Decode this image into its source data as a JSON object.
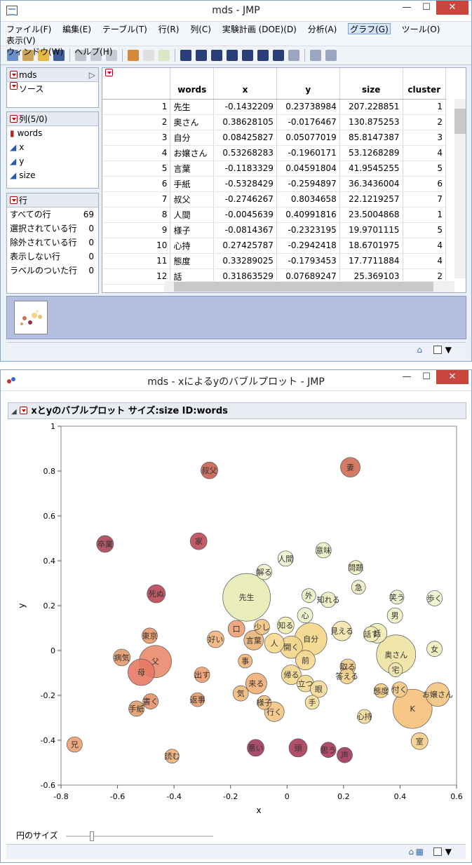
{
  "window1": {
    "title": "mds - JMP",
    "menus": [
      "ファイル(F)",
      "編集(E)",
      "テーブル(T)",
      "行(R)",
      "列(C)",
      "実験計画 (DOE)(D)",
      "分析(A)",
      "グラフ(G)",
      "ツール(O)",
      "表示(V)",
      "ウィンドウ(W)",
      "ヘルプ(H)"
    ],
    "selected_menu": "グラフ(G)",
    "left_panel": {
      "table_name": "mds",
      "source": "ソース",
      "columns_header": "列(5/0)",
      "columns": [
        "words",
        "x",
        "y",
        "size"
      ],
      "rows_header": "行",
      "row_stats": [
        {
          "label": "すべての行",
          "value": "69"
        },
        {
          "label": "選択されている行",
          "value": "0"
        },
        {
          "label": "除外されている行",
          "value": "0"
        },
        {
          "label": "表示しない行",
          "value": "0"
        },
        {
          "label": "ラベルのついた行",
          "value": "0"
        }
      ]
    },
    "table": {
      "headers": [
        "words",
        "x",
        "y",
        "size",
        "cluster"
      ],
      "rows": [
        [
          "1",
          "先生",
          "-0.1432209",
          "0.23738984",
          "207.228851",
          "1"
        ],
        [
          "2",
          "奥さん",
          "0.38628105",
          "-0.0176467",
          "130.875253",
          "2"
        ],
        [
          "3",
          "自分",
          "0.08425827",
          "0.05077019",
          "85.8147387",
          "3"
        ],
        [
          "4",
          "お嬢さん",
          "0.53268283",
          "-0.1960171",
          "53.1268289",
          "4"
        ],
        [
          "5",
          "言葉",
          "-0.1183329",
          "0.04591804",
          "41.9545255",
          "5"
        ],
        [
          "6",
          "手紙",
          "-0.5328429",
          "-0.2594897",
          "36.3436004",
          "6"
        ],
        [
          "7",
          "叔父",
          "-0.2746267",
          "0.8034658",
          "22.1219257",
          "7"
        ],
        [
          "8",
          "人間",
          "-0.0045639",
          "0.40991816",
          "23.5004868",
          "1"
        ],
        [
          "9",
          "様子",
          "-0.0814367",
          "-0.2323195",
          "19.9701115",
          "5"
        ],
        [
          "10",
          "心持",
          "0.27425787",
          "-0.2942418",
          "18.6701975",
          "4"
        ],
        [
          "11",
          "態度",
          "0.33289025",
          "-0.1793453",
          "17.7711884",
          "4"
        ],
        [
          "12",
          "話",
          "0.31863529",
          "0.07689247",
          "25.369103",
          "2"
        ]
      ]
    }
  },
  "window2": {
    "title": "mds - xによるyのバブルプロット - JMP",
    "report_title": "xとyのバブルプロット サイズ:size ID:words",
    "bubble_size_label": "円のサイズ",
    "colors": {
      "c1": "#9b2f4a",
      "c2": "#c25a4d",
      "c3": "#e39b64",
      "c4": "#f2d48a",
      "c5": "#e8efb8"
    }
  },
  "chart_data": {
    "type": "scatter",
    "title": "",
    "xlabel": "x",
    "ylabel": "y",
    "xlim": [
      -0.8,
      0.6
    ],
    "ylim": [
      -0.6,
      1.0
    ],
    "xticks": [
      -0.8,
      -0.6,
      -0.4,
      -0.2,
      0,
      0.2,
      0.4,
      0.6
    ],
    "yticks": [
      1,
      0.8,
      0.6,
      0.4,
      0.2,
      0,
      -0.2,
      -0.4,
      -0.6
    ],
    "points": [
      {
        "label": "先生",
        "x": -0.143,
        "y": 0.237,
        "r": 34,
        "c": "#e6ebb4"
      },
      {
        "label": "奥さん",
        "x": 0.386,
        "y": -0.018,
        "r": 28,
        "c": "#f0e3a0"
      },
      {
        "label": "自分",
        "x": 0.084,
        "y": 0.051,
        "r": 23,
        "c": "#f5d78a"
      },
      {
        "label": "お嬢さん",
        "x": 0.533,
        "y": -0.196,
        "r": 17,
        "c": "#f4c57e"
      },
      {
        "label": "言葉",
        "x": -0.118,
        "y": 0.046,
        "r": 14,
        "c": "#ebb577"
      },
      {
        "label": "手紙",
        "x": -0.533,
        "y": -0.259,
        "r": 11,
        "c": "#e29c68"
      },
      {
        "label": "叔父",
        "x": -0.275,
        "y": 0.803,
        "r": 12,
        "c": "#c86150"
      },
      {
        "label": "妻",
        "x": 0.224,
        "y": 0.817,
        "r": 14,
        "c": "#cf6b54"
      },
      {
        "label": "人間",
        "x": -0.005,
        "y": 0.41,
        "r": 11,
        "c": "#eef2cd"
      },
      {
        "label": "様子",
        "x": -0.081,
        "y": -0.232,
        "r": 10,
        "c": "#f1c07d"
      },
      {
        "label": "心持",
        "x": 0.274,
        "y": -0.294,
        "r": 10,
        "c": "#f6dc97"
      },
      {
        "label": "態度",
        "x": 0.333,
        "y": -0.179,
        "r": 10,
        "c": "#f5cd86"
      },
      {
        "label": "話",
        "x": 0.319,
        "y": 0.077,
        "r": 14,
        "c": "#f1ebb6"
      },
      {
        "label": "K",
        "x": 0.444,
        "y": -0.26,
        "r": 28,
        "c": "#f7c07a"
      },
      {
        "label": "卒業",
        "x": -0.644,
        "y": 0.475,
        "r": 12,
        "c": "#ad4558"
      },
      {
        "label": "家",
        "x": -0.313,
        "y": 0.487,
        "r": 12,
        "c": "#bd4a55"
      },
      {
        "label": "死ぬ",
        "x": -0.463,
        "y": 0.253,
        "r": 13,
        "c": "#b94756"
      },
      {
        "label": "東京",
        "x": -0.486,
        "y": 0.066,
        "r": 11,
        "c": "#e79869"
      },
      {
        "label": "病気",
        "x": -0.585,
        "y": -0.031,
        "r": 12,
        "c": "#e59a6a"
      },
      {
        "label": "父",
        "x": -0.466,
        "y": -0.049,
        "r": 23,
        "c": "#e9896b"
      },
      {
        "label": "母",
        "x": -0.516,
        "y": -0.097,
        "r": 19,
        "c": "#e57a64"
      },
      {
        "label": "出す",
        "x": -0.301,
        "y": -0.108,
        "r": 11,
        "c": "#ef9c6e"
      },
      {
        "label": "書く",
        "x": -0.483,
        "y": -0.227,
        "r": 11,
        "c": "#e8916a"
      },
      {
        "label": "返事",
        "x": -0.317,
        "y": -0.219,
        "r": 10,
        "c": "#e9996b"
      },
      {
        "label": "兄",
        "x": -0.752,
        "y": -0.419,
        "r": 11,
        "c": "#ef9f70"
      },
      {
        "label": "読む",
        "x": -0.407,
        "y": -0.471,
        "r": 10,
        "c": "#f2b177"
      },
      {
        "label": "解る",
        "x": -0.081,
        "y": 0.35,
        "r": 11,
        "c": "#eef1cc"
      },
      {
        "label": "好い",
        "x": -0.253,
        "y": 0.05,
        "r": 12,
        "c": "#f1b47a"
      },
      {
        "label": "口",
        "x": -0.179,
        "y": 0.097,
        "r": 12,
        "c": "#ef9f72"
      },
      {
        "label": "少し",
        "x": -0.089,
        "y": 0.105,
        "r": 11,
        "c": "#f1c37e"
      },
      {
        "label": "事",
        "x": -0.148,
        "y": -0.047,
        "r": 10,
        "c": "#f3b679"
      },
      {
        "label": "来る",
        "x": -0.109,
        "y": -0.147,
        "r": 15,
        "c": "#f1ae75"
      },
      {
        "label": "気",
        "x": -0.164,
        "y": -0.191,
        "r": 11,
        "c": "#f3b979"
      },
      {
        "label": "行く",
        "x": -0.045,
        "y": -0.273,
        "r": 14,
        "c": "#f3c483"
      },
      {
        "label": "知る",
        "x": -0.005,
        "y": 0.112,
        "r": 12,
        "c": "#f0ebb2"
      },
      {
        "label": "人",
        "x": -0.045,
        "y": 0.033,
        "r": 14,
        "c": "#f6d98e"
      },
      {
        "label": "開く",
        "x": 0.015,
        "y": 0.015,
        "r": 16,
        "c": "#f3d58a"
      },
      {
        "label": "前",
        "x": 0.065,
        "y": -0.043,
        "r": 14,
        "c": "#f5d78f"
      },
      {
        "label": "帰る",
        "x": 0.015,
        "y": -0.108,
        "r": 14,
        "c": "#f3d88d"
      },
      {
        "label": "立つ",
        "x": 0.065,
        "y": -0.147,
        "r": 12,
        "c": "#f4d790"
      },
      {
        "label": "眼",
        "x": 0.112,
        "y": -0.172,
        "r": 12,
        "c": "#f7db97"
      },
      {
        "label": "手",
        "x": 0.089,
        "y": -0.231,
        "r": 10,
        "c": "#f5dd99"
      },
      {
        "label": "心",
        "x": 0.064,
        "y": 0.157,
        "r": 11,
        "c": "#eaf1c5"
      },
      {
        "label": "外",
        "x": 0.077,
        "y": 0.245,
        "r": 10,
        "c": "#eaf0c7"
      },
      {
        "label": "知れる",
        "x": 0.146,
        "y": 0.226,
        "r": 11,
        "c": "#eff0c3"
      },
      {
        "label": "意味",
        "x": 0.129,
        "y": 0.447,
        "r": 11,
        "c": "#eaf0c7"
      },
      {
        "label": "問題",
        "x": 0.243,
        "y": 0.37,
        "r": 10,
        "c": "#efeec0"
      },
      {
        "label": "急",
        "x": 0.253,
        "y": 0.282,
        "r": 10,
        "c": "#efeec3"
      },
      {
        "label": "見える",
        "x": 0.194,
        "y": 0.087,
        "r": 14,
        "c": "#f3e5ad"
      },
      {
        "label": "話す",
        "x": 0.298,
        "y": 0.073,
        "r": 11,
        "c": "#f1ebb6"
      },
      {
        "label": "笑う",
        "x": 0.389,
        "y": 0.238,
        "r": 10,
        "c": "#ecf2ce"
      },
      {
        "label": "男",
        "x": 0.382,
        "y": 0.156,
        "r": 11,
        "c": "#eef0c5"
      },
      {
        "label": "歩く",
        "x": 0.522,
        "y": 0.233,
        "r": 11,
        "c": "#ecf2ce"
      },
      {
        "label": "女",
        "x": 0.522,
        "y": 0.007,
        "r": 11,
        "c": "#f1eebd"
      },
      {
        "label": "宅",
        "x": 0.384,
        "y": -0.086,
        "r": 10,
        "c": "#f2e6b0"
      },
      {
        "label": "取る",
        "x": 0.215,
        "y": -0.072,
        "r": 11,
        "c": "#f4c986"
      },
      {
        "label": "答える",
        "x": 0.212,
        "y": -0.114,
        "r": 11,
        "c": "#f4d189"
      },
      {
        "label": "付く",
        "x": 0.398,
        "y": -0.174,
        "r": 11,
        "c": "#f5c984"
      },
      {
        "label": "室",
        "x": 0.469,
        "y": -0.404,
        "r": 12,
        "c": "#f7cd89"
      },
      {
        "label": "悪い",
        "x": -0.111,
        "y": -0.434,
        "r": 12,
        "c": "#a23b5b"
      },
      {
        "label": "頭",
        "x": 0.039,
        "y": -0.434,
        "r": 13,
        "c": "#a83c59"
      },
      {
        "label": "思う",
        "x": 0.146,
        "y": -0.443,
        "r": 11,
        "c": "#a83a59"
      },
      {
        "label": "声",
        "x": 0.204,
        "y": -0.466,
        "r": 11,
        "c": "#a0375a"
      }
    ]
  }
}
